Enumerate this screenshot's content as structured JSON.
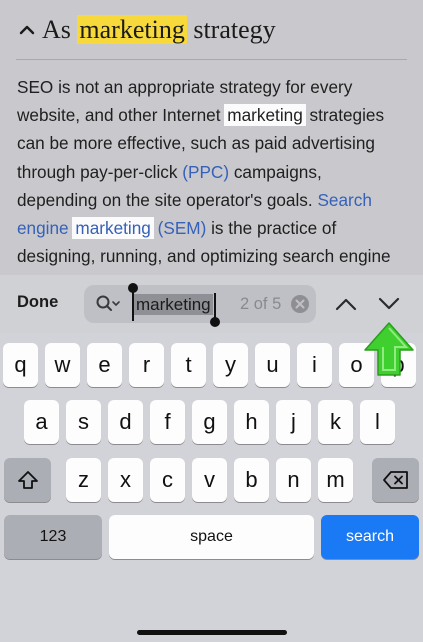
{
  "article": {
    "heading_prefix": "As ",
    "heading_highlight": "marketing",
    "heading_suffix": " strategy",
    "lines": [
      [
        {
          "t": "SEO is not an appropriate strategy for every"
        }
      ],
      [
        {
          "t": "website, and other Internet "
        },
        {
          "t": "marketing",
          "hl": true
        },
        {
          "t": " strategies"
        }
      ],
      [
        {
          "t": "can be more effective, such as paid advertising"
        }
      ],
      [
        {
          "t": "through pay-per-click "
        },
        {
          "t": "(PPC)",
          "link": true
        },
        {
          "t": " campaigns,"
        }
      ],
      [
        {
          "t": "depending on the site operator's goals. "
        },
        {
          "t": "Search",
          "link": true
        }
      ],
      [
        {
          "t": "engine ",
          "link": true
        },
        {
          "t": "marketing",
          "link": true,
          "hl": true
        },
        {
          "t": " (SEM)",
          "link": true
        },
        {
          "t": " is the practice of"
        }
      ],
      [
        {
          "t": "designing, running, and optimizing search engine"
        }
      ]
    ]
  },
  "find_bar": {
    "done_label": "Done",
    "query": "marketing",
    "match_count": "2 of 5",
    "search_icon": "magnifier-with-chevron-icon",
    "clear_icon": "clear-circle-icon",
    "prev_icon": "chevron-up-icon",
    "next_icon": "chevron-down-icon"
  },
  "keyboard": {
    "row1": [
      "q",
      "w",
      "e",
      "r",
      "t",
      "y",
      "u",
      "i",
      "o",
      "p"
    ],
    "row2": [
      "a",
      "s",
      "d",
      "f",
      "g",
      "h",
      "j",
      "k",
      "l"
    ],
    "row3": [
      "z",
      "x",
      "c",
      "v",
      "b",
      "n",
      "m"
    ],
    "shift_icon": "shift-icon",
    "backspace_icon": "backspace-icon",
    "numbers_label": "123",
    "space_label": "space",
    "search_label": "search"
  },
  "colors": {
    "highlight_current": "#f7d93c",
    "highlight_other": "#fbfbfb",
    "link": "#3561b8",
    "search_key": "#1a7af6",
    "arrow": "#3fcf2e"
  }
}
